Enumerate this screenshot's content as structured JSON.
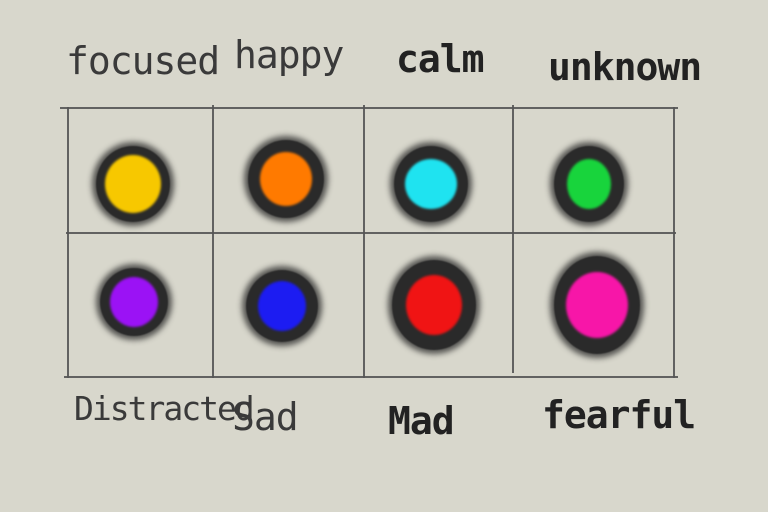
{
  "top_labels": [
    "focused",
    "happy",
    "calm",
    "unknown"
  ],
  "bottom_labels": [
    "Distracted",
    "Sad",
    "Mad",
    "fearful"
  ],
  "rows": [
    [
      {
        "name": "focused",
        "color": "#f7c800"
      },
      {
        "name": "happy",
        "color": "#ff7a00"
      },
      {
        "name": "calm",
        "color": "#1fe3f0"
      },
      {
        "name": "unknown",
        "color": "#18d43c"
      }
    ],
    [
      {
        "name": "Distracted",
        "color": "#9b12f5"
      },
      {
        "name": "Sad",
        "color": "#1c1cf2"
      },
      {
        "name": "Mad",
        "color": "#f01414"
      },
      {
        "name": "fearful",
        "color": "#f716a8"
      }
    ]
  ]
}
